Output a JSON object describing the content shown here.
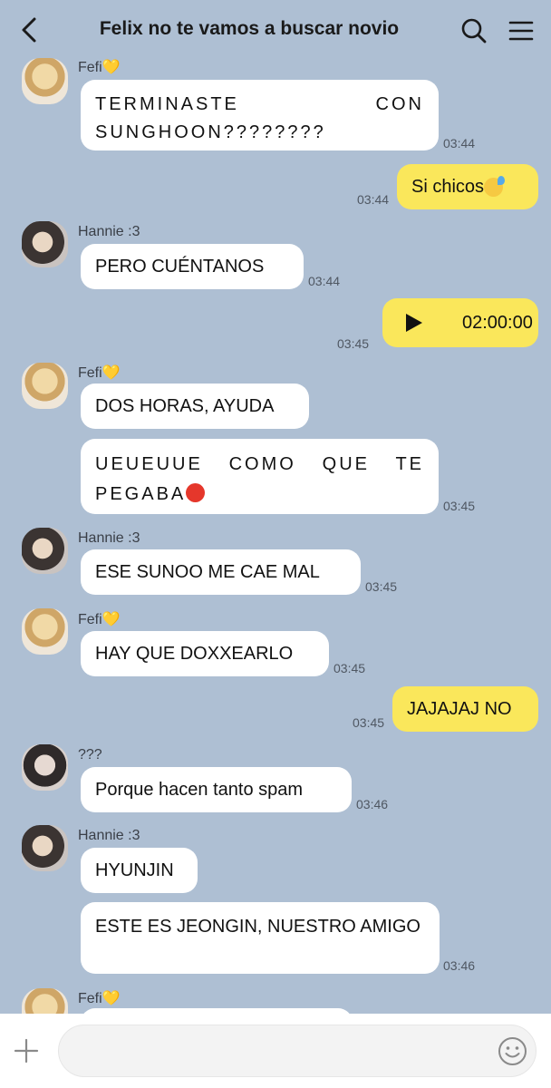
{
  "header": {
    "title": "Felix no te vamos a buscar novio",
    "back_icon": "chevron-left-icon",
    "search_icon": "search-icon",
    "menu_icon": "hamburger-menu-icon"
  },
  "senders": {
    "fefi": "Fefi",
    "hannie": "Hannie :3",
    "unknown": "???"
  },
  "messages": {
    "m1": {
      "text": "TERMINASTE CON SUNGHOON????????",
      "time": "03:44"
    },
    "m2": {
      "text": "Si chicos",
      "emoji": "sweat-emoji",
      "time": "03:44"
    },
    "m3": {
      "text": "PERO CUÉNTANOS",
      "time": "03:44"
    },
    "m4": {
      "duration": "02:00:00",
      "time": "03:45",
      "icon": "play-icon"
    },
    "m5": {
      "text": "DOS HORAS, AYUDA"
    },
    "m6": {
      "text": "UEUEUUE COMO QUE TE PEGABA",
      "emoji": "angry-emoji",
      "time": "03:45"
    },
    "m7": {
      "text": "ESE SUNOO ME CAE MAL",
      "time": "03:45"
    },
    "m8": {
      "text": "HAY QUE DOXXEARLO",
      "time": "03:45"
    },
    "m9": {
      "text": "JAJAJAJ NO",
      "time": "03:45"
    },
    "m10": {
      "text": "Porque hacen tanto spam",
      "time": "03:46"
    },
    "m11": {
      "text": "HYUNJIN"
    },
    "m12": {
      "text": "ESTE ES JEONGIN, NUESTRO AMIGO",
      "time": "03:46"
    }
  },
  "input": {
    "placeholder": "",
    "value": "",
    "plus_icon": "plus-icon",
    "emoji_icon": "smiley-icon"
  },
  "colors": {
    "background": "#aebfd3",
    "outgoing_bubble": "#fae75b",
    "incoming_bubble": "#ffffff",
    "heart": "#f3c21b"
  }
}
